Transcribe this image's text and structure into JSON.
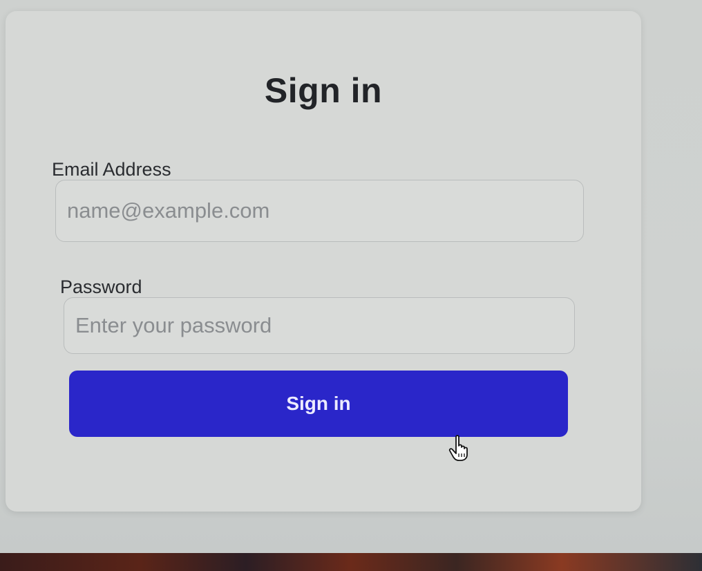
{
  "signin": {
    "title": "Sign in",
    "email": {
      "label": "Email Address",
      "placeholder": "name@example.com",
      "value": ""
    },
    "password": {
      "label": "Password",
      "placeholder": "Enter your password",
      "value": ""
    },
    "submit_label": "Sign in"
  },
  "colors": {
    "accent": "#2a26c9",
    "background": "#cfd2d0",
    "card": "#d6d8d6"
  },
  "icons": {
    "cursor": "hand-pointer-icon"
  }
}
